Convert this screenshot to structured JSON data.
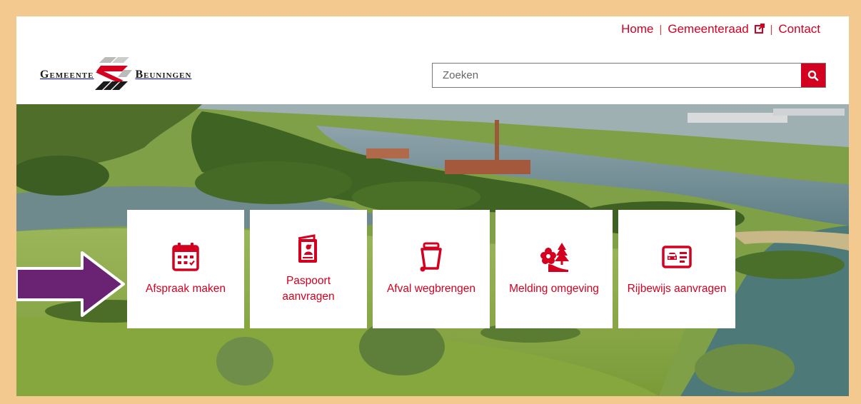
{
  "topnav": {
    "home": "Home",
    "council": "Gemeenteraad",
    "contact": "Contact"
  },
  "logo": {
    "left": "Gemeente",
    "right": "Beuningen"
  },
  "search": {
    "placeholder": "Zoeken"
  },
  "tiles": [
    {
      "label": "Afspraak maken",
      "icon": "calendar-icon"
    },
    {
      "label": "Paspoort aanvragen",
      "icon": "passport-icon"
    },
    {
      "label": "Afval wegbrengen",
      "icon": "waste-bin-icon"
    },
    {
      "label": "Melding omgeving",
      "icon": "environment-icon"
    },
    {
      "label": "Rijbewijs aanvragen",
      "icon": "driving-license-icon"
    }
  ],
  "colors": {
    "brand_red": "#d3001f",
    "frame": "#f3c98f",
    "annotation_arrow": "#6a2273"
  }
}
